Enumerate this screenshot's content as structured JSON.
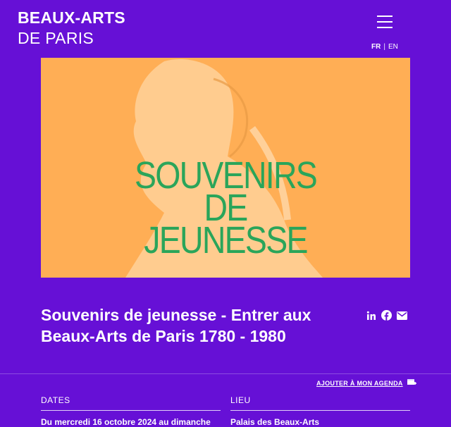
{
  "header": {
    "logo_line1": "BEAUX-ARTS",
    "logo_line2": "DE PARIS",
    "menu_icon": "hamburger-menu-icon",
    "lang_fr": "FR",
    "lang_separator": "|",
    "lang_en": "EN"
  },
  "hero": {
    "line1": "SOUVENIRS",
    "line2": "DE",
    "line3": "JEUNESSE",
    "background_color": "#ffae55",
    "text_color": "#2aa55a"
  },
  "event": {
    "title": "Souvenirs de jeunesse - Entrer aux Beaux-Arts de Paris 1780 - 1980"
  },
  "share": {
    "icons": [
      "linkedin-icon",
      "facebook-icon",
      "email-icon"
    ]
  },
  "agenda": {
    "label": "AJOUTER À MON AGENDA",
    "icon": "calendar-add-icon"
  },
  "dates": {
    "label": "DATES",
    "value": "Du mercredi 16 octobre 2024 au dimanche"
  },
  "location": {
    "label": "LIEU",
    "value": "Palais des Beaux-Arts"
  },
  "colors": {
    "background": "#6610d6",
    "text": "#ffffff"
  }
}
